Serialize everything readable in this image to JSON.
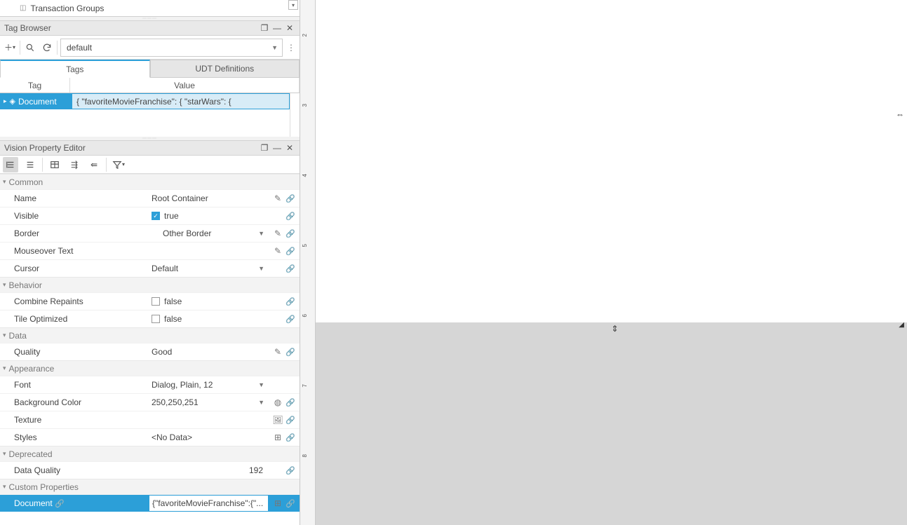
{
  "top_tree": {
    "label": "Transaction Groups"
  },
  "tag_browser": {
    "title": "Tag Browser",
    "provider": "default",
    "tabs": {
      "tags": "Tags",
      "udt": "UDT Definitions"
    },
    "columns": {
      "tag": "Tag",
      "value": "Value"
    },
    "row": {
      "name": "Document",
      "value": "{     \"favoriteMovieFranchise\": {         \"starWars\": {"
    }
  },
  "vpe": {
    "title": "Vision Property Editor",
    "sections": {
      "common": "Common",
      "behavior": "Behavior",
      "data": "Data",
      "appearance": "Appearance",
      "deprecated": "Deprecated",
      "custom": "Custom Properties"
    },
    "props": {
      "name_label": "Name",
      "name_value": "Root Container",
      "visible_label": "Visible",
      "visible_value": "true",
      "border_label": "Border",
      "border_value": "Other Border",
      "mouseover_label": "Mouseover Text",
      "mouseover_value": "",
      "cursor_label": "Cursor",
      "cursor_value": "Default",
      "combine_label": "Combine Repaints",
      "combine_value": "false",
      "tile_label": "Tile Optimized",
      "tile_value": "false",
      "quality_label": "Quality",
      "quality_value": "Good",
      "font_label": "Font",
      "font_value": "Dialog, Plain, 12",
      "bg_label": "Background Color",
      "bg_value": "250,250,251",
      "texture_label": "Texture",
      "texture_value": "",
      "styles_label": "Styles",
      "styles_value": "<No Data>",
      "dq_label": "Data Quality",
      "dq_value": "192",
      "doc_label": "Document",
      "doc_value": "{\"favoriteMovieFranchise\":{\"..."
    }
  },
  "ruler": {
    "ticks": [
      "2",
      "3",
      "4",
      "5",
      "6",
      "7",
      "8"
    ]
  }
}
